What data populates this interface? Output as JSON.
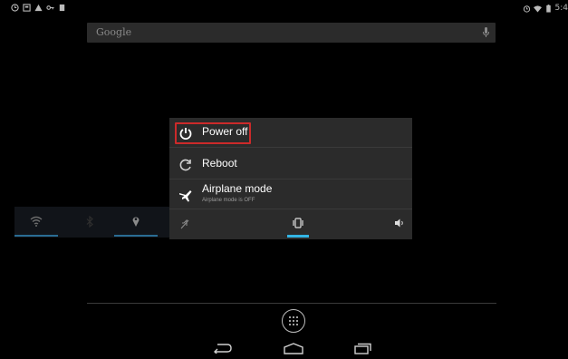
{
  "search": {
    "placeholder": "Google"
  },
  "global_actions": {
    "items": [
      {
        "label": "Power off",
        "icon": "power-icon",
        "highlighted": true
      },
      {
        "label": "Reboot",
        "icon": "reboot-icon"
      },
      {
        "label": "Airplane mode",
        "sublabel": "Airplane mode is OFF",
        "icon": "airplane-icon"
      }
    ],
    "sound_modes": [
      {
        "icon": "silent-icon",
        "selected": false
      },
      {
        "icon": "vibrate-icon",
        "selected": true
      },
      {
        "icon": "volume-icon",
        "selected": false
      }
    ]
  },
  "status_bar": {
    "left_icons": [
      "clock-icon",
      "storage-icon",
      "warning-icon",
      "key-icon",
      "battery-small-icon"
    ],
    "right_icons": [
      "alarm-icon",
      "wifi-icon",
      "battery-icon"
    ],
    "time": "5:4"
  },
  "widget": {
    "items": [
      "wifi-icon",
      "bluetooth-icon",
      "location-icon"
    ]
  },
  "colors": {
    "accent": "#33b5e5",
    "highlight_border": "#cc2a2a",
    "dialog_bg": "#2b2b2b"
  }
}
